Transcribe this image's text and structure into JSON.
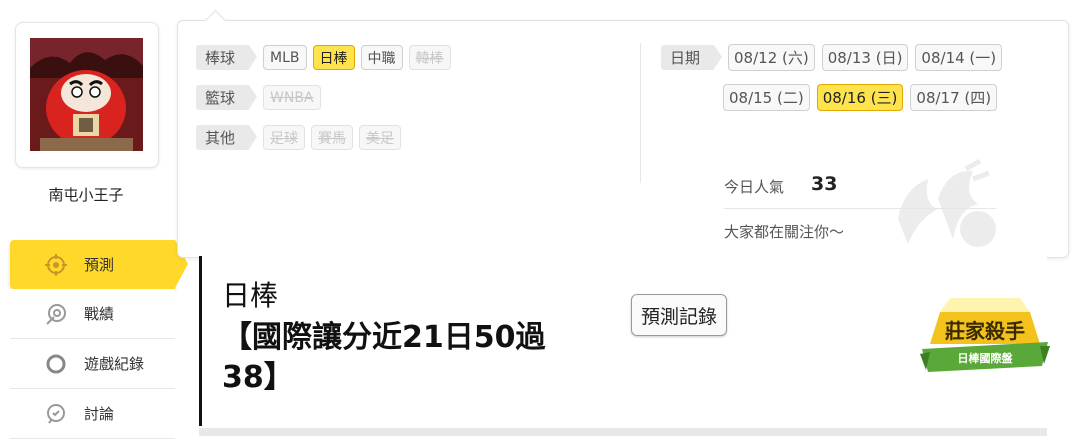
{
  "user": {
    "name": "南屯小王子"
  },
  "nav": {
    "items": [
      {
        "label": "預測",
        "icon": "target-icon",
        "active": true
      },
      {
        "label": "戰績",
        "icon": "record-icon",
        "active": false
      },
      {
        "label": "遊戲紀錄",
        "icon": "circle-icon",
        "active": false
      },
      {
        "label": "討論",
        "icon": "discussion-icon",
        "active": false
      }
    ]
  },
  "filters": {
    "baseball": {
      "label": "棒球",
      "options": [
        "MLB",
        "日棒",
        "中職",
        "韓棒"
      ]
    },
    "basketball": {
      "label": "籃球",
      "options": [
        "WNBA"
      ]
    },
    "other": {
      "label": "其他",
      "options": [
        "足球",
        "賽馬",
        "美足"
      ]
    },
    "date": {
      "label": "日期",
      "options": [
        "08/12 (六)",
        "08/13 (日)",
        "08/14 (一)",
        "08/15 (二)",
        "08/16 (三)",
        "08/17 (四)"
      ]
    }
  },
  "popularity": {
    "label": "今日人氣",
    "value": "33",
    "message": "大家都在關注你～"
  },
  "content": {
    "category": "日棒",
    "title": "【國際讓分近21日50過38】",
    "record_button": "預測記錄",
    "badge": {
      "main": "莊家殺手",
      "sub": "日棒國際盤"
    }
  },
  "colors": {
    "accent": "#ffd82a",
    "chip_active": "#ffe34d"
  }
}
